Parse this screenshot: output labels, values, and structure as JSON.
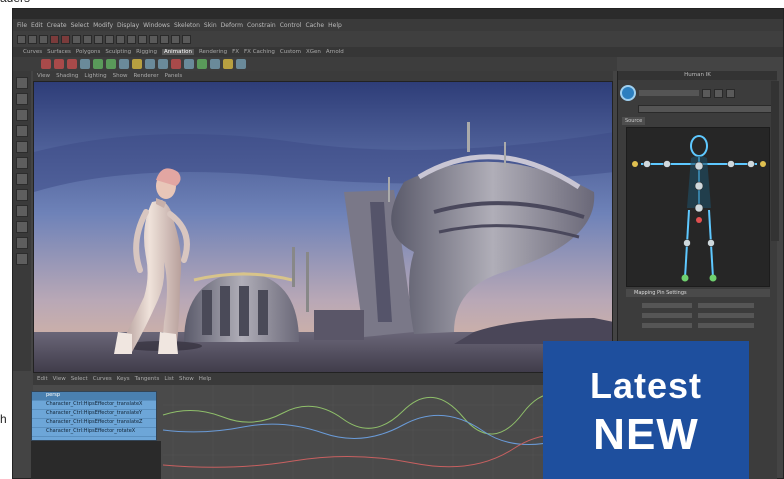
{
  "cropped_text": {
    "top": "aders",
    "left": "h"
  },
  "menu": {
    "items": [
      "File",
      "Edit",
      "Create",
      "Select",
      "Modify",
      "Display",
      "Windows",
      "Skeleton",
      "Skin",
      "Deform",
      "Constrain",
      "Control",
      "Cache",
      "Help"
    ]
  },
  "shelf": {
    "tabs": [
      "Curves",
      "Surfaces",
      "Polygons",
      "Sculpting",
      "Rigging",
      "Animation",
      "Rendering",
      "FX",
      "FX Caching",
      "Custom",
      "XGen",
      "Arnold",
      "Bifrost",
      "MASH",
      "Motion",
      "Graphics",
      "TURTLE"
    ],
    "active_tab": "Animation"
  },
  "viewport_menu": {
    "items": [
      "View",
      "Shading",
      "Lighting",
      "Show",
      "Renderer",
      "Panels"
    ]
  },
  "time_controls": {
    "items": [
      "Edit",
      "View",
      "Select",
      "Curves",
      "Keys",
      "Tangents",
      "List",
      "Show",
      "Help"
    ]
  },
  "outliner": {
    "header": "persp",
    "rows": [
      "Character_Ctrl:HipsEffector_translateX",
      "Character_Ctrl:HipsEffector_translateY",
      "Character_Ctrl:HipsEffector_translateZ",
      "Character_Ctrl:HipsEffector_rotateX"
    ]
  },
  "right_panel": {
    "title": "Human IK",
    "label": "Source",
    "section": "Mapping Pin Settings"
  },
  "badge": {
    "line1": "Latest",
    "line2": "NEW",
    "color": "#1e4f9e"
  },
  "icons": [
    "menu-icons",
    "shelf-icons",
    "tool-icons",
    "humanik-logo-icon"
  ]
}
